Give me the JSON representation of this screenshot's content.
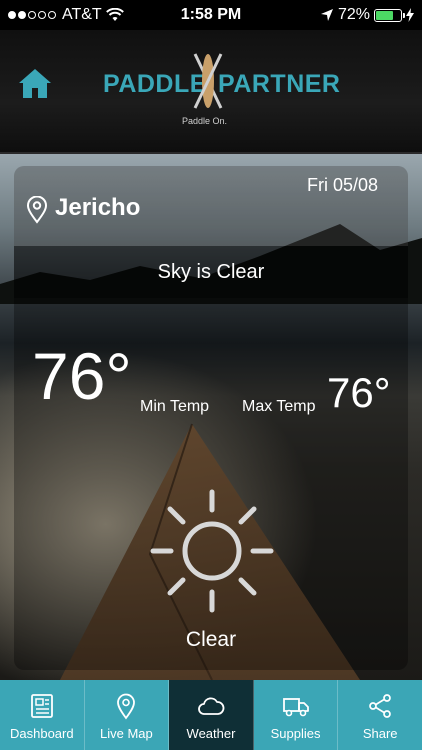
{
  "status_bar": {
    "carrier": "AT&T",
    "time": "1:58 PM",
    "battery": "72%",
    "battery_level": 0.72
  },
  "header": {
    "brand_left": "PADDLE",
    "brand_right": "PARTNER",
    "tagline": "Paddle On."
  },
  "weather": {
    "city": "Jericho",
    "date": "Fri 05/08",
    "sky": "Sky is Clear",
    "current_temp": "76°",
    "min_label": "Min Temp",
    "max_label": "Max Temp",
    "max_temp": "76°",
    "condition": "Clear",
    "icon": "sun-icon"
  },
  "tabs": [
    {
      "label": "Dashboard",
      "icon": "newspaper-icon",
      "active": false
    },
    {
      "label": "Live Map",
      "icon": "map-pin-icon",
      "active": false
    },
    {
      "label": "Weather",
      "icon": "cloud-icon",
      "active": true
    },
    {
      "label": "Supplies",
      "icon": "truck-icon",
      "active": false
    },
    {
      "label": "Share",
      "icon": "share-icon",
      "active": false
    }
  ],
  "colors": {
    "accent": "#3ba6b6",
    "active_tab": "#0f2f36",
    "battery": "#4cd964"
  }
}
